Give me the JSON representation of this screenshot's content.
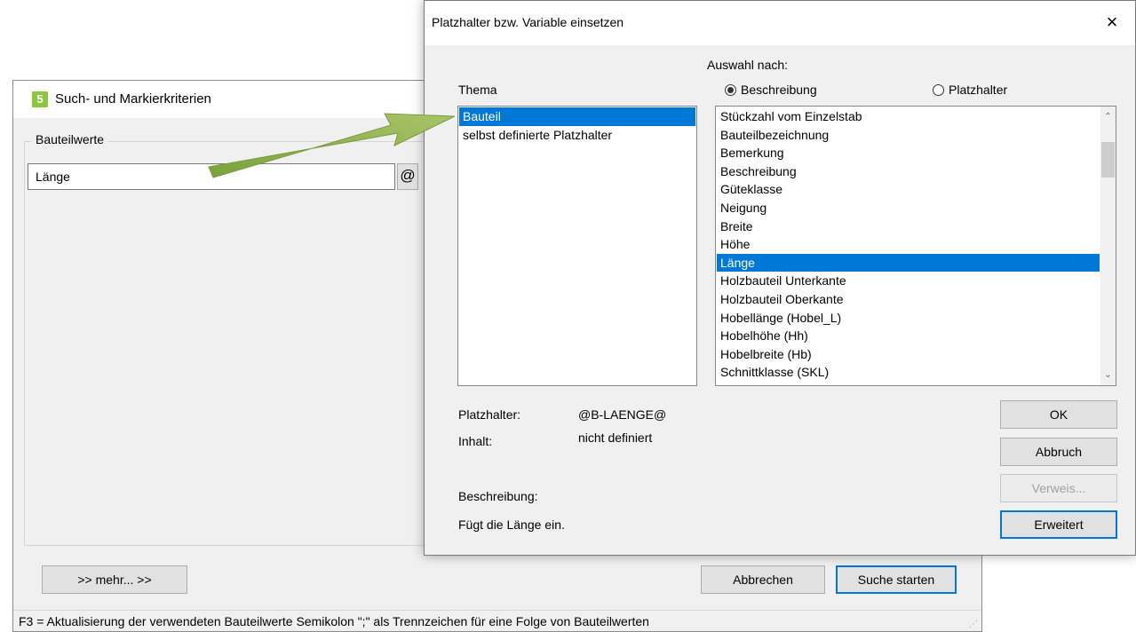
{
  "background_window": {
    "title": "Such- und Markierkriterien",
    "app_icon_letter": "5",
    "group_label": "Bauteilwerte",
    "input_value": "Länge",
    "at_button_label": "@",
    "more_button_label": ">>  mehr...  >>",
    "cancel_button_label": "Abbrechen",
    "search_button_label": "Suche starten",
    "status_text": "F3 = Aktualisierung der verwendeten Bauteilwerte    Semikolon \";\" als Trennzeichen für eine Folge von Bauteilwerten"
  },
  "dialog": {
    "title": "Platzhalter bzw. Variable einsetzen",
    "close_icon": "×",
    "theme_label": "Thema",
    "selection_label": "Auswahl nach:",
    "radio_description": "Beschreibung",
    "radio_placeholder": "Platzhalter",
    "radio_selected": "Beschreibung",
    "theme_items": [
      {
        "label": "Bauteil",
        "selected": true
      },
      {
        "label": "selbst definierte Platzhalter",
        "selected": false
      }
    ],
    "field_items": [
      {
        "label": "Stückzahl vom Einzelstab",
        "selected": false
      },
      {
        "label": "Bauteilbezeichnung",
        "selected": false
      },
      {
        "label": "Bemerkung",
        "selected": false
      },
      {
        "label": "Beschreibung",
        "selected": false
      },
      {
        "label": "Güteklasse",
        "selected": false
      },
      {
        "label": "Neigung",
        "selected": false
      },
      {
        "label": "Breite",
        "selected": false
      },
      {
        "label": "Höhe",
        "selected": false
      },
      {
        "label": "Länge",
        "selected": true
      },
      {
        "label": "Holzbauteil Unterkante",
        "selected": false
      },
      {
        "label": "Holzbauteil Oberkante",
        "selected": false
      },
      {
        "label": "Hobellänge (Hobel_L)",
        "selected": false
      },
      {
        "label": "Hobelhöhe (Hh)",
        "selected": false
      },
      {
        "label": "Hobelbreite (Hb)",
        "selected": false
      },
      {
        "label": "Schnittklasse (SKL)",
        "selected": false
      }
    ],
    "placeholder_label": "Platzhalter:",
    "placeholder_value": "@B-LAENGE@",
    "content_label": "Inhalt:",
    "content_value": "nicht definiert",
    "description_label": "Beschreibung:",
    "description_value": "Fügt die Länge ein.",
    "buttons": {
      "ok": "OK",
      "cancel": "Abbruch",
      "reference": "Verweis...",
      "extended": "Erweitert"
    }
  },
  "colors": {
    "selection": "#0078d7",
    "app_icon": "#8cc63f",
    "arrow": "#8fb04a"
  }
}
